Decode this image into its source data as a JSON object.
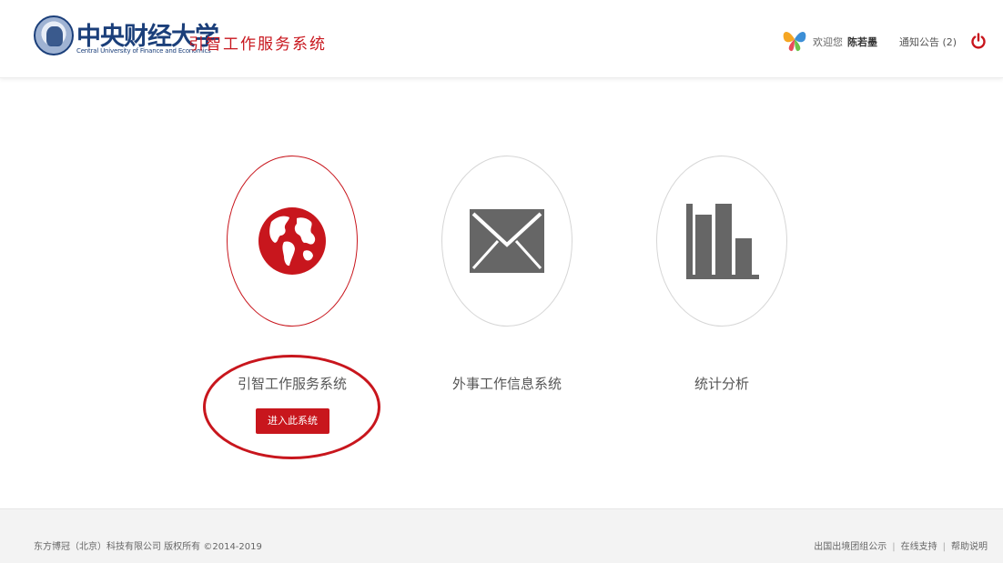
{
  "header": {
    "logo_cn": "中央财经大学",
    "logo_en": "Central University of Finance and Economics",
    "app_title": "引智工作服务系统",
    "welcome_text": "欢迎您",
    "username": "陈若墨",
    "notice_label": "通知公告 (2)"
  },
  "main": {
    "systems": [
      {
        "label": "引智工作服务系统",
        "icon": "globe-icon",
        "selected": true
      },
      {
        "label": "外事工作信息系统",
        "icon": "envelope-icon",
        "selected": false
      },
      {
        "label": "统计分析",
        "icon": "bar-chart-icon",
        "selected": false
      }
    ],
    "enter_button_label": "进入此系统"
  },
  "footer": {
    "copyright": "东方博冠（北京）科技有限公司 版权所有 ©2014-2019",
    "links": [
      "出国出境团组公示",
      "在线支持",
      "帮助说明"
    ]
  },
  "colors": {
    "accent": "#c8161d",
    "icon_gray": "#666666",
    "brand_blue": "#1b3f7a"
  }
}
